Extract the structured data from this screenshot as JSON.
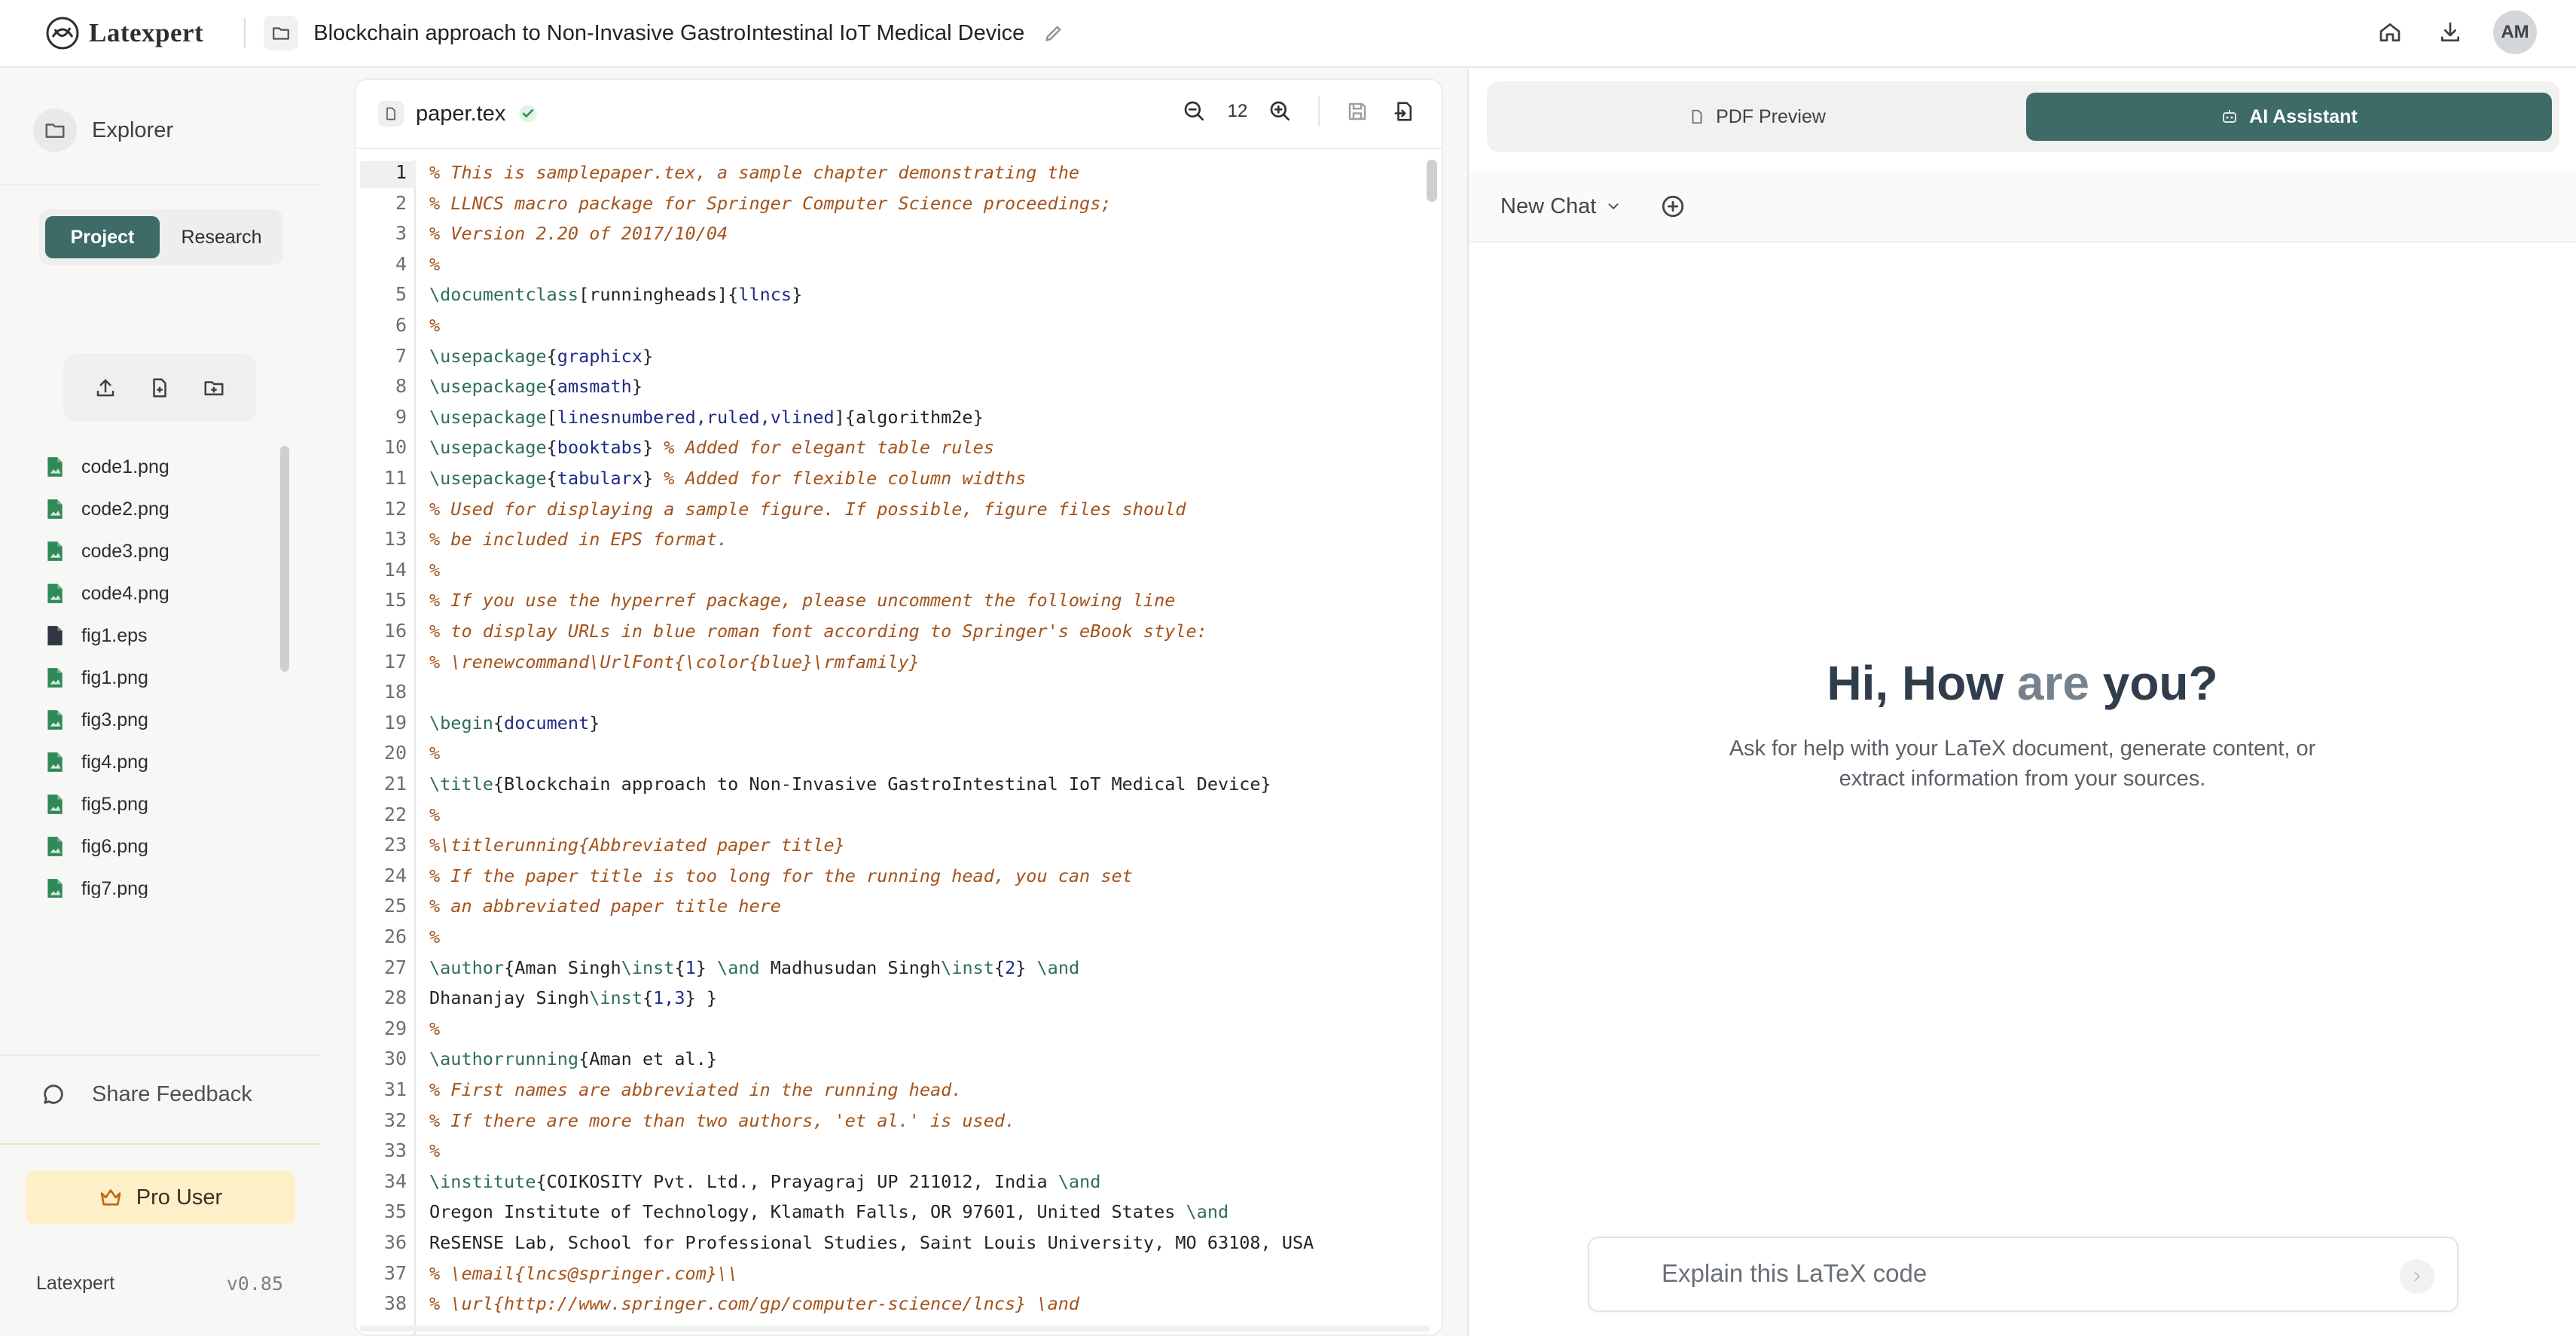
{
  "app": {
    "brand": "Latexpert",
    "doc_title": "Blockchain approach to Non-Invasive GastroIntestinal IoT Medical Device",
    "avatar_initials": "AM",
    "accent_color": "#3e6b67"
  },
  "sidebar": {
    "explorer_label": "Explorer",
    "tabs": [
      {
        "label": "Project",
        "active": true
      },
      {
        "label": "Research",
        "active": false
      }
    ],
    "file_actions": [
      "upload-icon",
      "new-file-icon",
      "new-folder-icon"
    ],
    "files": [
      {
        "name": "code1.png",
        "icon": "image-file-icon"
      },
      {
        "name": "code2.png",
        "icon": "image-file-icon"
      },
      {
        "name": "code3.png",
        "icon": "image-file-icon"
      },
      {
        "name": "code4.png",
        "icon": "image-file-icon"
      },
      {
        "name": "fig1.eps",
        "icon": "eps-file-icon"
      },
      {
        "name": "fig1.png",
        "icon": "image-file-icon"
      },
      {
        "name": "fig3.png",
        "icon": "image-file-icon"
      },
      {
        "name": "fig4.png",
        "icon": "image-file-icon"
      },
      {
        "name": "fig5.png",
        "icon": "image-file-icon"
      },
      {
        "name": "fig6.png",
        "icon": "image-file-icon"
      },
      {
        "name": "fig7.png",
        "icon": "image-file-icon"
      }
    ],
    "feedback_label": "Share Feedback",
    "pro_label": "Pro User",
    "footer_brand": "Latexpert",
    "version": "v0.85"
  },
  "editor": {
    "file_name": "paper.tex",
    "font_size": "12",
    "active_line": 1,
    "lines": [
      [
        [
          "c",
          "% This is samplepaper.tex, a sample chapter demonstrating the"
        ]
      ],
      [
        [
          "c",
          "% LLNCS macro package for Springer Computer Science proceedings;"
        ]
      ],
      [
        [
          "c",
          "% Version 2.20 of 2017/10/04"
        ]
      ],
      [
        [
          "c",
          "%"
        ]
      ],
      [
        [
          "k",
          "\\documentclass"
        ],
        [
          "t",
          "[runningheads]{"
        ],
        [
          "a",
          "llncs"
        ],
        [
          "t",
          "}"
        ]
      ],
      [
        [
          "c",
          "%"
        ]
      ],
      [
        [
          "k",
          "\\usepackage"
        ],
        [
          "t",
          "{"
        ],
        [
          "a",
          "graphicx"
        ],
        [
          "t",
          "}"
        ]
      ],
      [
        [
          "k",
          "\\usepackage"
        ],
        [
          "t",
          "{"
        ],
        [
          "a",
          "amsmath"
        ],
        [
          "t",
          "}"
        ]
      ],
      [
        [
          "k",
          "\\usepackage"
        ],
        [
          "t",
          "["
        ],
        [
          "a",
          "linesnumbered,ruled,vlined"
        ],
        [
          "t",
          "]{algorithm2e}"
        ]
      ],
      [
        [
          "k",
          "\\usepackage"
        ],
        [
          "t",
          "{"
        ],
        [
          "a",
          "booktabs"
        ],
        [
          "t",
          "} "
        ],
        [
          "c",
          "% Added for elegant table rules"
        ]
      ],
      [
        [
          "k",
          "\\usepackage"
        ],
        [
          "t",
          "{"
        ],
        [
          "a",
          "tabularx"
        ],
        [
          "t",
          "} "
        ],
        [
          "c",
          "% Added for flexible column widths"
        ]
      ],
      [
        [
          "c",
          "% Used for displaying a sample figure. If possible, figure files should"
        ]
      ],
      [
        [
          "c",
          "% be included in EPS format."
        ]
      ],
      [
        [
          "c",
          "%"
        ]
      ],
      [
        [
          "c",
          "% If you use the hyperref package, please uncomment the following line"
        ]
      ],
      [
        [
          "c",
          "% to display URLs in blue roman font according to Springer's eBook style:"
        ]
      ],
      [
        [
          "c",
          "% \\renewcommand\\UrlFont{\\color{blue}\\rmfamily}"
        ]
      ],
      [
        [
          "t",
          ""
        ]
      ],
      [
        [
          "k",
          "\\begin"
        ],
        [
          "t",
          "{"
        ],
        [
          "a",
          "document"
        ],
        [
          "t",
          "}"
        ]
      ],
      [
        [
          "c",
          "%"
        ]
      ],
      [
        [
          "k",
          "\\title"
        ],
        [
          "t",
          "{Blockchain approach to Non-Invasive GastroIntestinal IoT Medical Device}"
        ]
      ],
      [
        [
          "c",
          "%"
        ]
      ],
      [
        [
          "c",
          "%\\titlerunning{Abbreviated paper title}"
        ]
      ],
      [
        [
          "c",
          "% If the paper title is too long for the running head, you can set"
        ]
      ],
      [
        [
          "c",
          "% an abbreviated paper title here"
        ]
      ],
      [
        [
          "c",
          "%"
        ]
      ],
      [
        [
          "k",
          "\\author"
        ],
        [
          "t",
          "{Aman Singh"
        ],
        [
          "k",
          "\\inst"
        ],
        [
          "t",
          "{"
        ],
        [
          "a",
          "1"
        ],
        [
          "t",
          "} "
        ],
        [
          "k",
          "\\and"
        ],
        [
          "t",
          " Madhusudan Singh"
        ],
        [
          "k",
          "\\inst"
        ],
        [
          "t",
          "{"
        ],
        [
          "a",
          "2"
        ],
        [
          "t",
          "} "
        ],
        [
          "k",
          "\\and"
        ]
      ],
      [
        [
          "t",
          "Dhananjay Singh"
        ],
        [
          "k",
          "\\inst"
        ],
        [
          "t",
          "{"
        ],
        [
          "a",
          "1,3"
        ],
        [
          "t",
          "} }"
        ]
      ],
      [
        [
          "c",
          "%"
        ]
      ],
      [
        [
          "k",
          "\\authorrunning"
        ],
        [
          "t",
          "{Aman et al.}"
        ]
      ],
      [
        [
          "c",
          "% First names are abbreviated in the running head."
        ]
      ],
      [
        [
          "c",
          "% If there are more than two authors, 'et al.' is used."
        ]
      ],
      [
        [
          "c",
          "%"
        ]
      ],
      [
        [
          "k",
          "\\institute"
        ],
        [
          "t",
          "{COIKOSITY Pvt. Ltd., Prayagraj UP 211012, India "
        ],
        [
          "k",
          "\\and"
        ]
      ],
      [
        [
          "t",
          "Oregon Institute of Technology, Klamath Falls, OR 97601, United States "
        ],
        [
          "k",
          "\\and"
        ]
      ],
      [
        [
          "t",
          "ReSENSE Lab, School for Professional Studies, Saint Louis University, MO 63108, USA"
        ]
      ],
      [
        [
          "c",
          "% \\email{lncs@springer.com}\\\\"
        ]
      ],
      [
        [
          "c",
          "% \\url{http://www.springer.com/gp/computer-science/lncs} \\and"
        ]
      ]
    ]
  },
  "right_panel": {
    "tabs": [
      {
        "label": "PDF Preview",
        "active": false
      },
      {
        "label": "AI Assistant",
        "active": true
      }
    ],
    "chat_select": "New Chat",
    "greeting_part1": "Hi, How ",
    "greeting_part2": "are",
    "greeting_part3": " you?",
    "sub_line1": "Ask for help with your LaTeX document, generate content, or",
    "sub_line2": "extract information from your sources.",
    "input_placeholder": "Explain this LaTeX code"
  }
}
